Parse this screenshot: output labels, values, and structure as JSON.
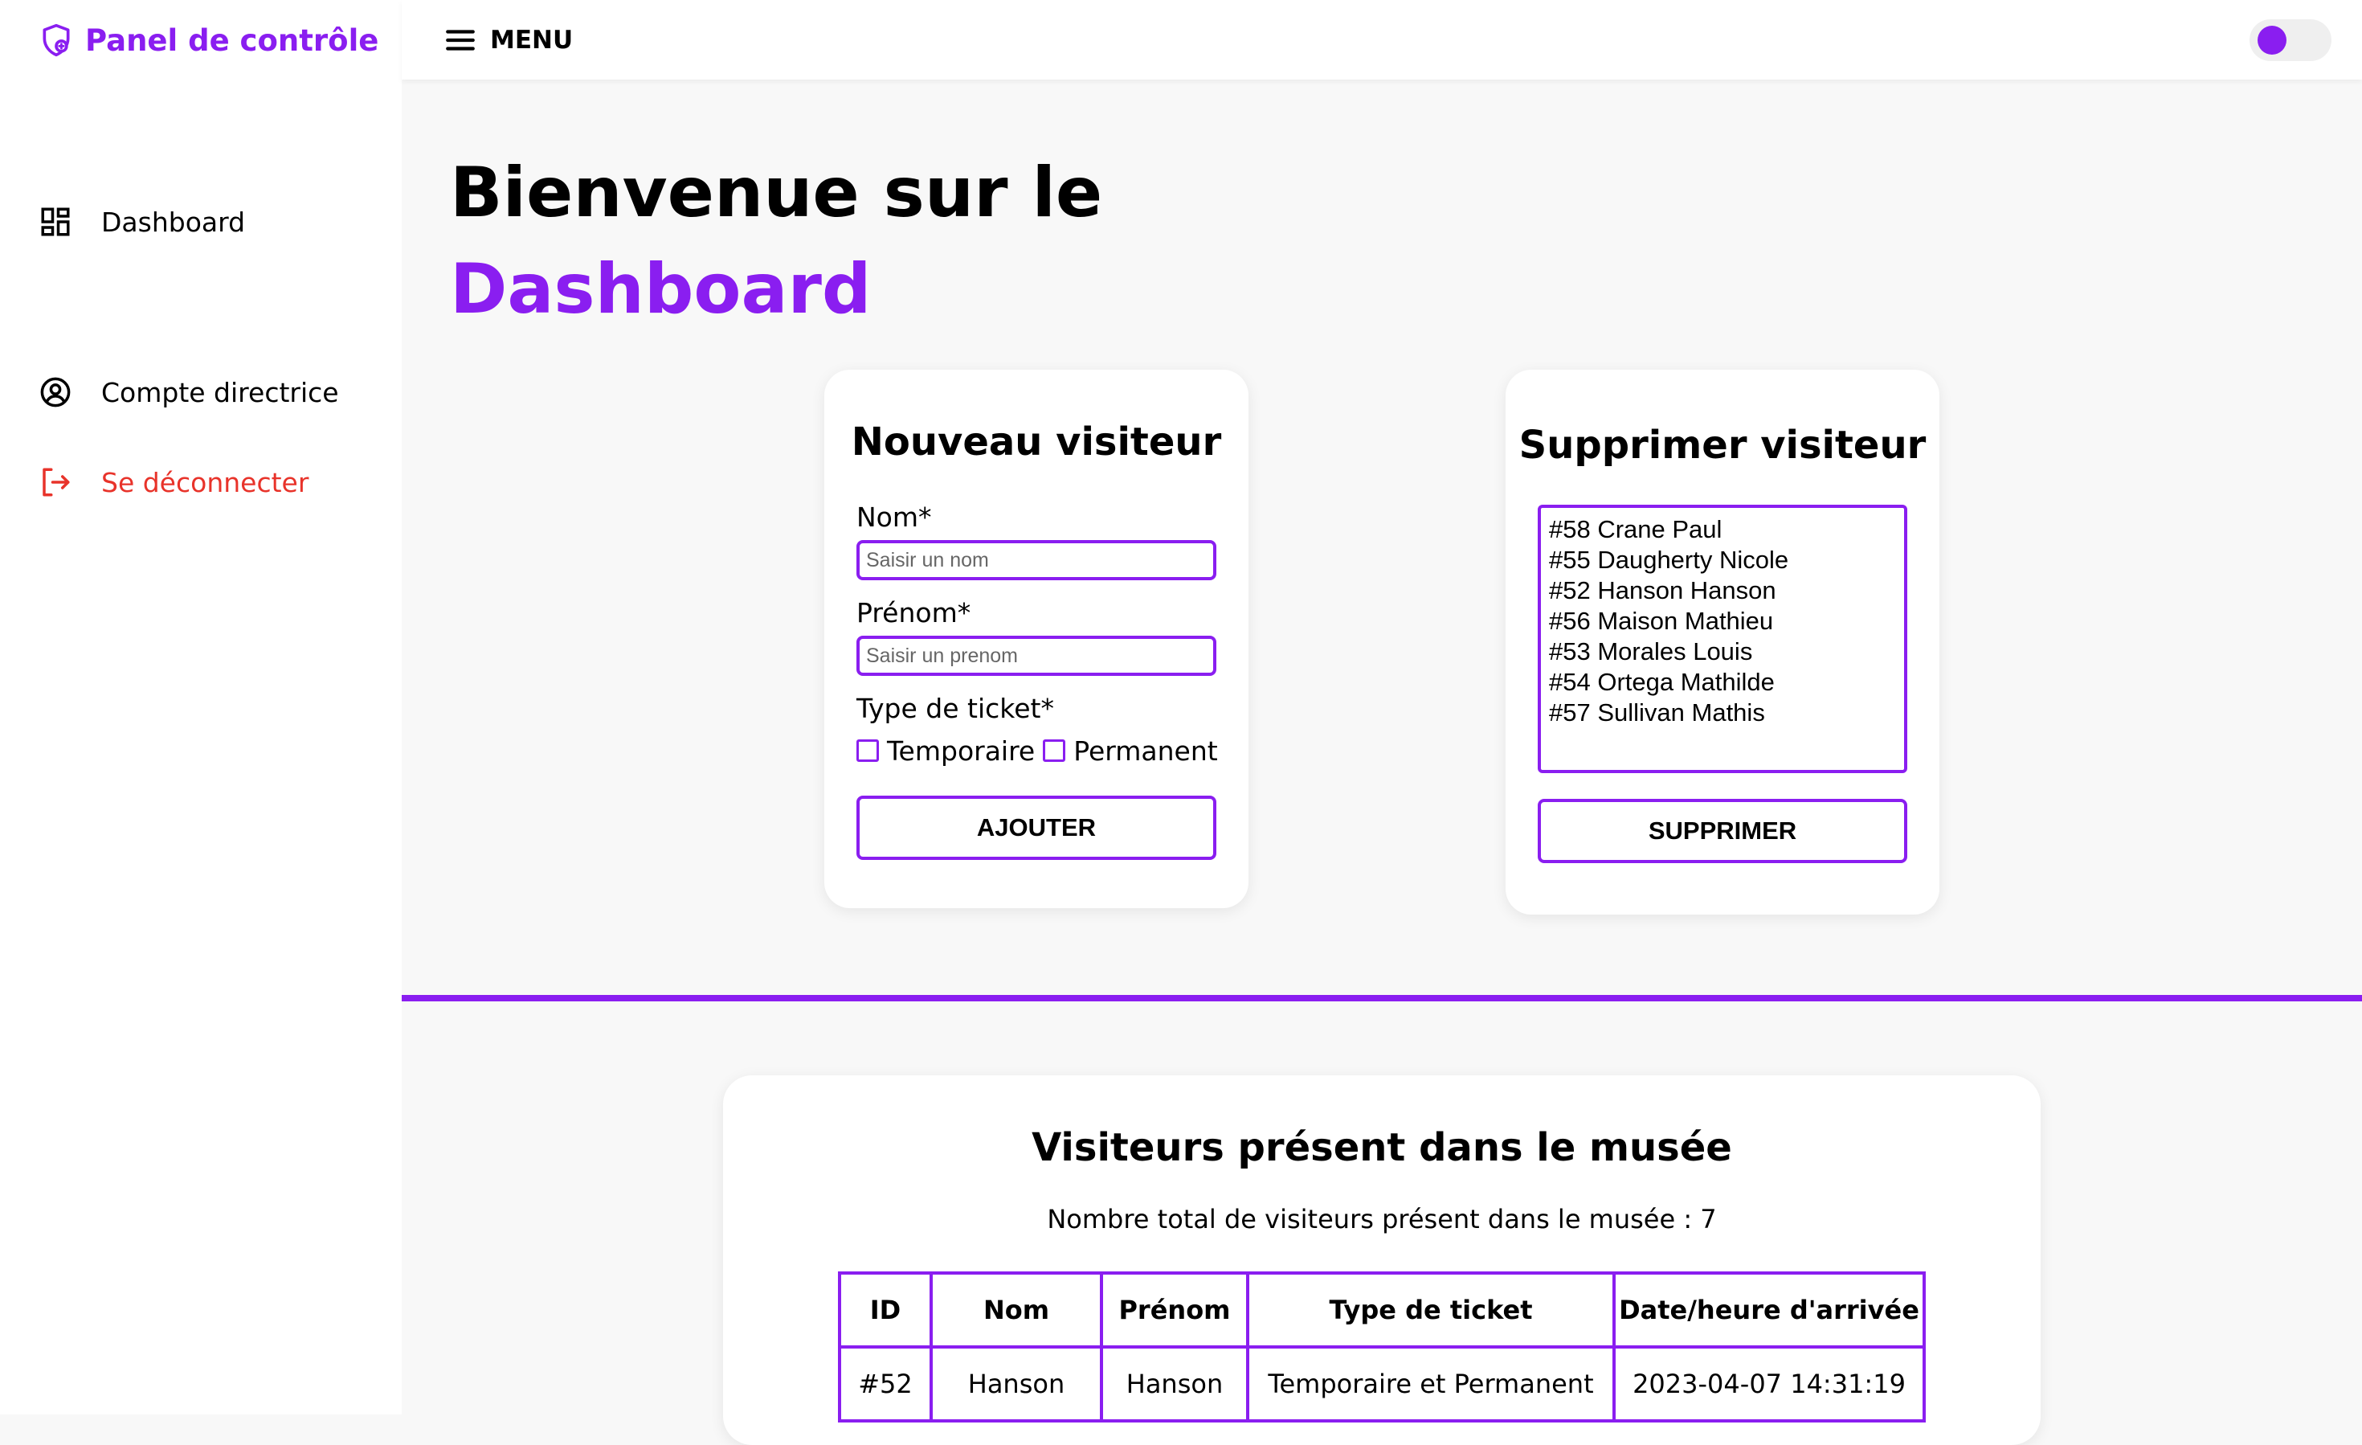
{
  "sidebar": {
    "brand": "Panel de contrôle",
    "items": [
      {
        "label": "Dashboard",
        "icon": "dashboard-icon"
      },
      {
        "label": "Compte directrice",
        "icon": "user-circle-icon"
      },
      {
        "label": "Se déconnecter",
        "icon": "logout-icon"
      }
    ]
  },
  "topbar": {
    "menu_label": "MENU"
  },
  "hero": {
    "line1": "Bienvenue sur le",
    "line2": "Dashboard"
  },
  "add_card": {
    "title": "Nouveau visiteur",
    "nom_label": "Nom*",
    "nom_placeholder": "Saisir un nom",
    "prenom_label": "Prénom*",
    "prenom_placeholder": "Saisir un prenom",
    "ticket_label": "Type de ticket*",
    "option_temp": "Temporaire",
    "option_perm": "Permanent",
    "button": "AJOUTER"
  },
  "delete_card": {
    "title": "Supprimer visiteur",
    "visitors": [
      "#58 Crane Paul",
      "#55 Daugherty Nicole",
      "#52 Hanson Hanson",
      "#56 Maison Mathieu",
      "#53 Morales Louis",
      "#54 Ortega Mathilde",
      "#57 Sullivan Mathis"
    ],
    "button": "SUPPRIMER"
  },
  "visitors_table": {
    "title": "Visiteurs présent dans le musée",
    "total_text": "Nombre total de visiteurs présent dans le musée : 7",
    "headers": [
      "ID",
      "Nom",
      "Prénom",
      "Type de ticket",
      "Date/heure d'arrivée"
    ],
    "rows": [
      [
        "#52",
        "Hanson",
        "Hanson",
        "Temporaire et Permanent",
        "2023-04-07 14:31:19"
      ]
    ]
  },
  "colors": {
    "accent": "#8a1ef0",
    "danger": "#e8332a",
    "background": "#f8f8f8"
  }
}
